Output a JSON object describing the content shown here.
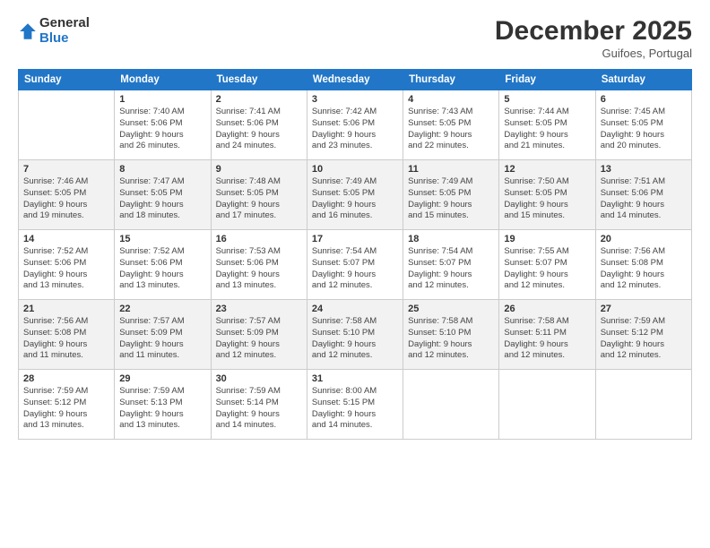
{
  "logo": {
    "general": "General",
    "blue": "Blue"
  },
  "title": "December 2025",
  "subtitle": "Guifoes, Portugal",
  "days_header": [
    "Sunday",
    "Monday",
    "Tuesday",
    "Wednesday",
    "Thursday",
    "Friday",
    "Saturday"
  ],
  "weeks": [
    [
      {
        "num": "",
        "info": ""
      },
      {
        "num": "1",
        "info": "Sunrise: 7:40 AM\nSunset: 5:06 PM\nDaylight: 9 hours\nand 26 minutes."
      },
      {
        "num": "2",
        "info": "Sunrise: 7:41 AM\nSunset: 5:06 PM\nDaylight: 9 hours\nand 24 minutes."
      },
      {
        "num": "3",
        "info": "Sunrise: 7:42 AM\nSunset: 5:06 PM\nDaylight: 9 hours\nand 23 minutes."
      },
      {
        "num": "4",
        "info": "Sunrise: 7:43 AM\nSunset: 5:05 PM\nDaylight: 9 hours\nand 22 minutes."
      },
      {
        "num": "5",
        "info": "Sunrise: 7:44 AM\nSunset: 5:05 PM\nDaylight: 9 hours\nand 21 minutes."
      },
      {
        "num": "6",
        "info": "Sunrise: 7:45 AM\nSunset: 5:05 PM\nDaylight: 9 hours\nand 20 minutes."
      }
    ],
    [
      {
        "num": "7",
        "info": "Sunrise: 7:46 AM\nSunset: 5:05 PM\nDaylight: 9 hours\nand 19 minutes."
      },
      {
        "num": "8",
        "info": "Sunrise: 7:47 AM\nSunset: 5:05 PM\nDaylight: 9 hours\nand 18 minutes."
      },
      {
        "num": "9",
        "info": "Sunrise: 7:48 AM\nSunset: 5:05 PM\nDaylight: 9 hours\nand 17 minutes."
      },
      {
        "num": "10",
        "info": "Sunrise: 7:49 AM\nSunset: 5:05 PM\nDaylight: 9 hours\nand 16 minutes."
      },
      {
        "num": "11",
        "info": "Sunrise: 7:49 AM\nSunset: 5:05 PM\nDaylight: 9 hours\nand 15 minutes."
      },
      {
        "num": "12",
        "info": "Sunrise: 7:50 AM\nSunset: 5:05 PM\nDaylight: 9 hours\nand 15 minutes."
      },
      {
        "num": "13",
        "info": "Sunrise: 7:51 AM\nSunset: 5:06 PM\nDaylight: 9 hours\nand 14 minutes."
      }
    ],
    [
      {
        "num": "14",
        "info": "Sunrise: 7:52 AM\nSunset: 5:06 PM\nDaylight: 9 hours\nand 13 minutes."
      },
      {
        "num": "15",
        "info": "Sunrise: 7:52 AM\nSunset: 5:06 PM\nDaylight: 9 hours\nand 13 minutes."
      },
      {
        "num": "16",
        "info": "Sunrise: 7:53 AM\nSunset: 5:06 PM\nDaylight: 9 hours\nand 13 minutes."
      },
      {
        "num": "17",
        "info": "Sunrise: 7:54 AM\nSunset: 5:07 PM\nDaylight: 9 hours\nand 12 minutes."
      },
      {
        "num": "18",
        "info": "Sunrise: 7:54 AM\nSunset: 5:07 PM\nDaylight: 9 hours\nand 12 minutes."
      },
      {
        "num": "19",
        "info": "Sunrise: 7:55 AM\nSunset: 5:07 PM\nDaylight: 9 hours\nand 12 minutes."
      },
      {
        "num": "20",
        "info": "Sunrise: 7:56 AM\nSunset: 5:08 PM\nDaylight: 9 hours\nand 12 minutes."
      }
    ],
    [
      {
        "num": "21",
        "info": "Sunrise: 7:56 AM\nSunset: 5:08 PM\nDaylight: 9 hours\nand 11 minutes."
      },
      {
        "num": "22",
        "info": "Sunrise: 7:57 AM\nSunset: 5:09 PM\nDaylight: 9 hours\nand 11 minutes."
      },
      {
        "num": "23",
        "info": "Sunrise: 7:57 AM\nSunset: 5:09 PM\nDaylight: 9 hours\nand 12 minutes."
      },
      {
        "num": "24",
        "info": "Sunrise: 7:58 AM\nSunset: 5:10 PM\nDaylight: 9 hours\nand 12 minutes."
      },
      {
        "num": "25",
        "info": "Sunrise: 7:58 AM\nSunset: 5:10 PM\nDaylight: 9 hours\nand 12 minutes."
      },
      {
        "num": "26",
        "info": "Sunrise: 7:58 AM\nSunset: 5:11 PM\nDaylight: 9 hours\nand 12 minutes."
      },
      {
        "num": "27",
        "info": "Sunrise: 7:59 AM\nSunset: 5:12 PM\nDaylight: 9 hours\nand 12 minutes."
      }
    ],
    [
      {
        "num": "28",
        "info": "Sunrise: 7:59 AM\nSunset: 5:12 PM\nDaylight: 9 hours\nand 13 minutes."
      },
      {
        "num": "29",
        "info": "Sunrise: 7:59 AM\nSunset: 5:13 PM\nDaylight: 9 hours\nand 13 minutes."
      },
      {
        "num": "30",
        "info": "Sunrise: 7:59 AM\nSunset: 5:14 PM\nDaylight: 9 hours\nand 14 minutes."
      },
      {
        "num": "31",
        "info": "Sunrise: 8:00 AM\nSunset: 5:15 PM\nDaylight: 9 hours\nand 14 minutes."
      },
      {
        "num": "",
        "info": ""
      },
      {
        "num": "",
        "info": ""
      },
      {
        "num": "",
        "info": ""
      }
    ]
  ]
}
